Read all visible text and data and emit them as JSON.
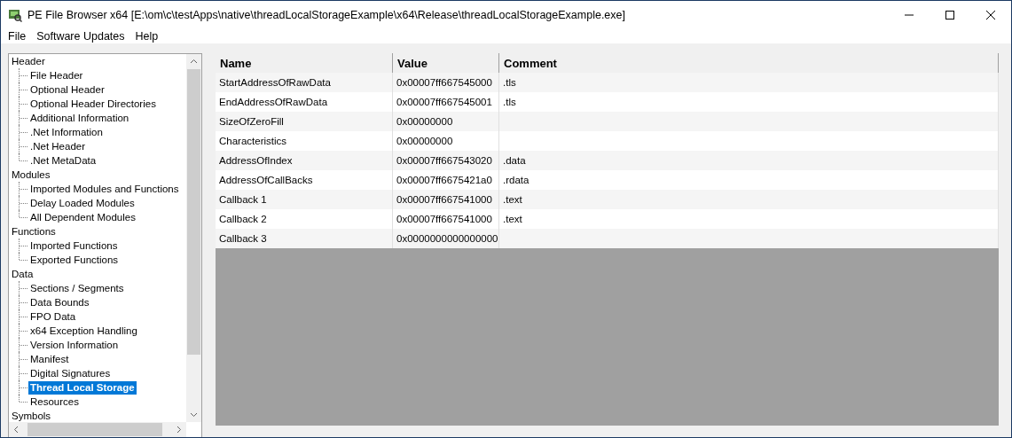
{
  "window": {
    "title": "PE File Browser x64 [E:\\om\\c\\testApps\\native\\threadLocalStorageExample\\x64\\Release\\threadLocalStorageExample.exe]"
  },
  "menu": [
    "File",
    "Software Updates",
    "Help"
  ],
  "tree": [
    {
      "label": "Header",
      "selected": false,
      "children": [
        {
          "label": "File Header",
          "selected": false
        },
        {
          "label": "Optional Header",
          "selected": false
        },
        {
          "label": "Optional Header Directories",
          "selected": false
        },
        {
          "label": "Additional Information",
          "selected": false
        },
        {
          "label": ".Net Information",
          "selected": false
        },
        {
          "label": ".Net Header",
          "selected": false
        },
        {
          "label": ".Net MetaData",
          "selected": false
        }
      ]
    },
    {
      "label": "Modules",
      "selected": false,
      "children": [
        {
          "label": "Imported Modules and Functions",
          "selected": false
        },
        {
          "label": "Delay Loaded Modules",
          "selected": false
        },
        {
          "label": "All Dependent Modules",
          "selected": false
        }
      ]
    },
    {
      "label": "Functions",
      "selected": false,
      "children": [
        {
          "label": "Imported Functions",
          "selected": false
        },
        {
          "label": "Exported Functions",
          "selected": false
        }
      ]
    },
    {
      "label": "Data",
      "selected": false,
      "children": [
        {
          "label": "Sections / Segments",
          "selected": false
        },
        {
          "label": "Data Bounds",
          "selected": false
        },
        {
          "label": "FPO Data",
          "selected": false
        },
        {
          "label": "x64 Exception Handling",
          "selected": false
        },
        {
          "label": "Version Information",
          "selected": false
        },
        {
          "label": "Manifest",
          "selected": false
        },
        {
          "label": "Digital Signatures",
          "selected": false
        },
        {
          "label": "Thread Local Storage",
          "selected": true
        },
        {
          "label": "Resources",
          "selected": false
        }
      ]
    },
    {
      "label": "Symbols",
      "selected": false
    }
  ],
  "table": {
    "columns": [
      "Name",
      "Value",
      "Comment"
    ],
    "rows": [
      [
        "StartAddressOfRawData",
        "0x00007ff667545000",
        ".tls"
      ],
      [
        "EndAddressOfRawData",
        "0x00007ff667545001",
        ".tls"
      ],
      [
        "SizeOfZeroFill",
        "0x00000000",
        ""
      ],
      [
        "Characteristics",
        "0x00000000",
        ""
      ],
      [
        "AddressOfIndex",
        "0x00007ff667543020",
        ".data"
      ],
      [
        "AddressOfCallBacks",
        "0x00007ff6675421a0",
        ".rdata"
      ],
      [
        "Callback 1",
        "0x00007ff667541000",
        ".text"
      ],
      [
        "Callback 2",
        "0x00007ff667541000",
        ".text"
      ],
      [
        "Callback 3",
        "0x0000000000000000",
        ""
      ]
    ]
  }
}
